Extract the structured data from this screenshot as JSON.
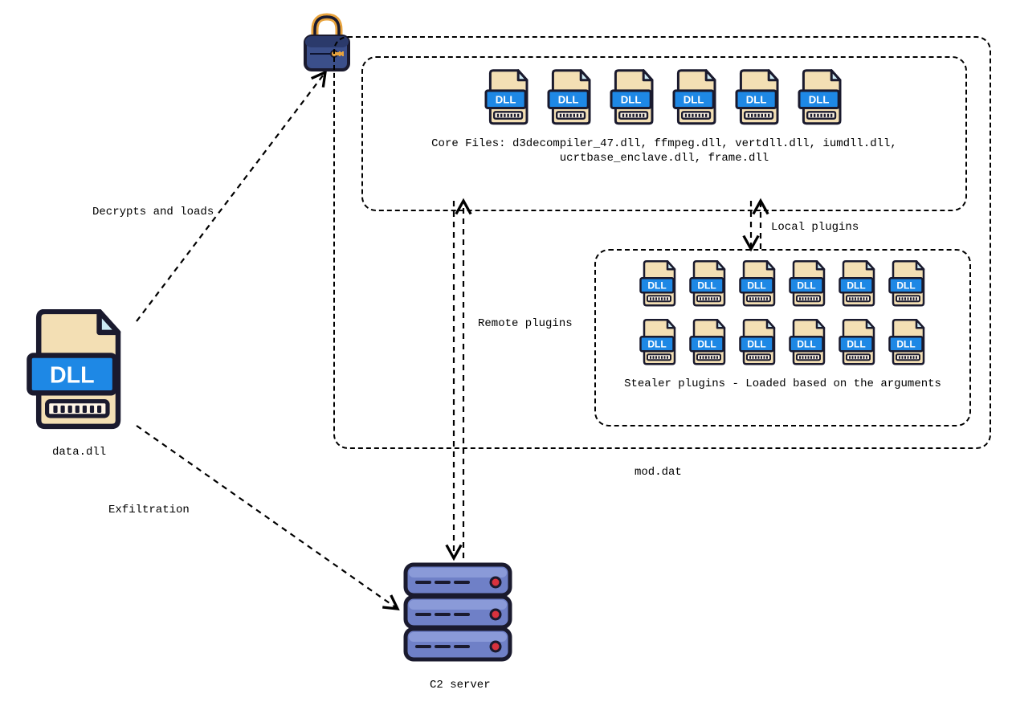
{
  "source": {
    "label": "data.dll",
    "dllTag": "DLL"
  },
  "arrows": {
    "decrypts": "Decrypts and loads",
    "exfiltration": "Exfiltration",
    "remotePlugins": "Remote plugins",
    "localPlugins": "Local plugins"
  },
  "moddat": {
    "label": "mod.dat"
  },
  "core": {
    "caption1": "Core Files: d3decompiler_47.dll, ffmpeg.dll, vertdll.dll, iumdll.dll,",
    "caption2": "ucrtbase_enclave.dll, frame.dll",
    "dllTag": "DLL",
    "count": 6
  },
  "plugins": {
    "caption": "Stealer plugins - Loaded based on the arguments",
    "dllTag": "DLL",
    "rows": 2,
    "cols": 6
  },
  "server": {
    "label": "C2 server"
  }
}
